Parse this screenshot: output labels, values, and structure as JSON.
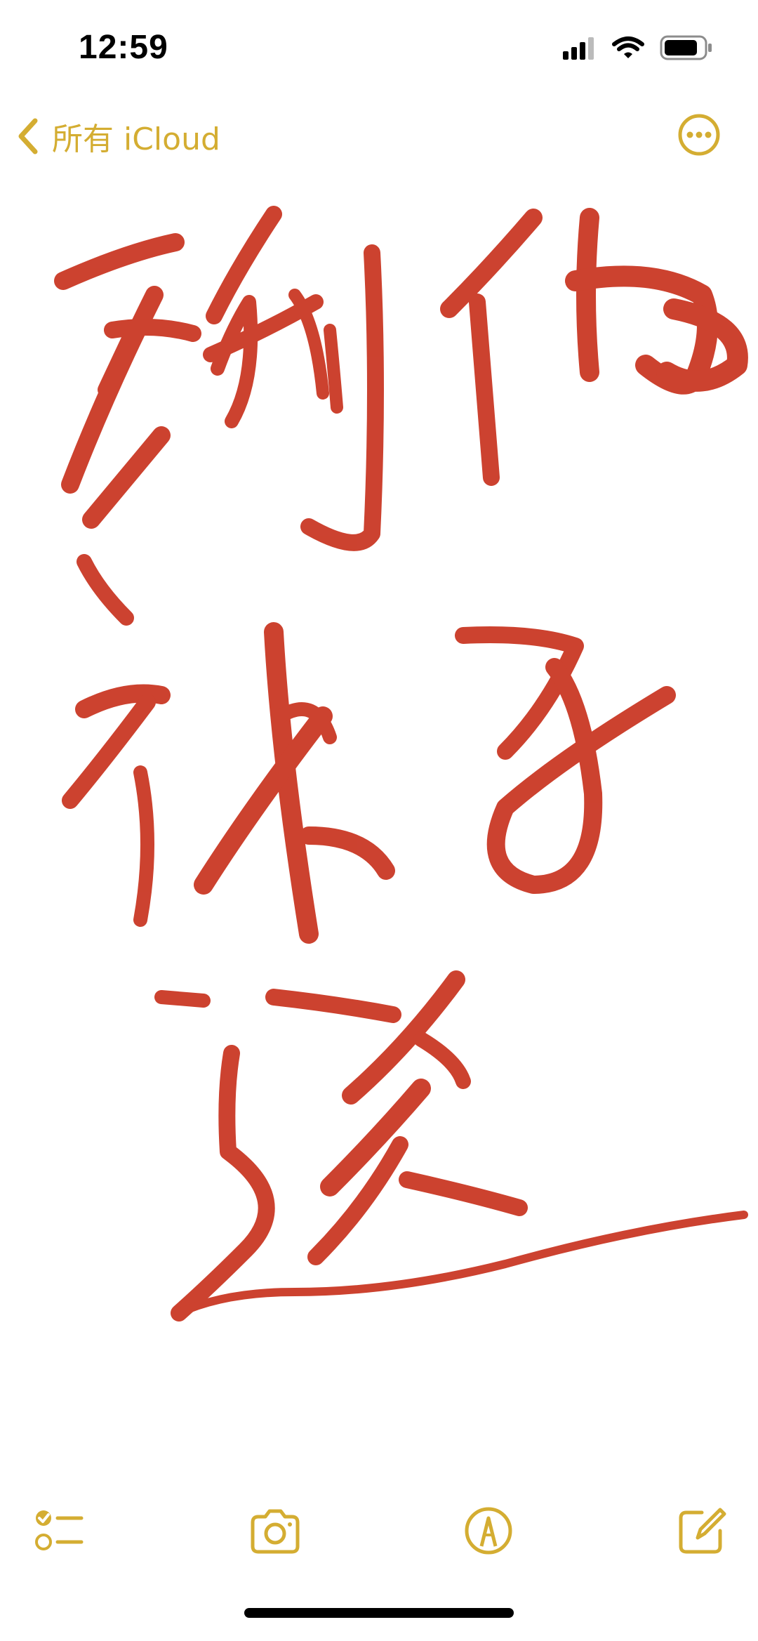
{
  "status_bar": {
    "time": "12:59",
    "icons": [
      "cellular-signal-icon",
      "wifi-icon",
      "battery-icon"
    ]
  },
  "nav": {
    "back_label": "所有 iCloud",
    "back_icon": "chevron-left-icon",
    "more_icon": "ellipsis-circle-icon"
  },
  "note": {
    "content_type": "handwritten-drawing",
    "ink_color": "#C8321E"
  },
  "toolbar": {
    "items": [
      {
        "icon": "checklist-icon"
      },
      {
        "icon": "camera-icon"
      },
      {
        "icon": "markup-pen-icon"
      },
      {
        "icon": "compose-icon"
      }
    ]
  },
  "colors": {
    "accent": "#D4AD32",
    "background": "#FFFFFF"
  }
}
